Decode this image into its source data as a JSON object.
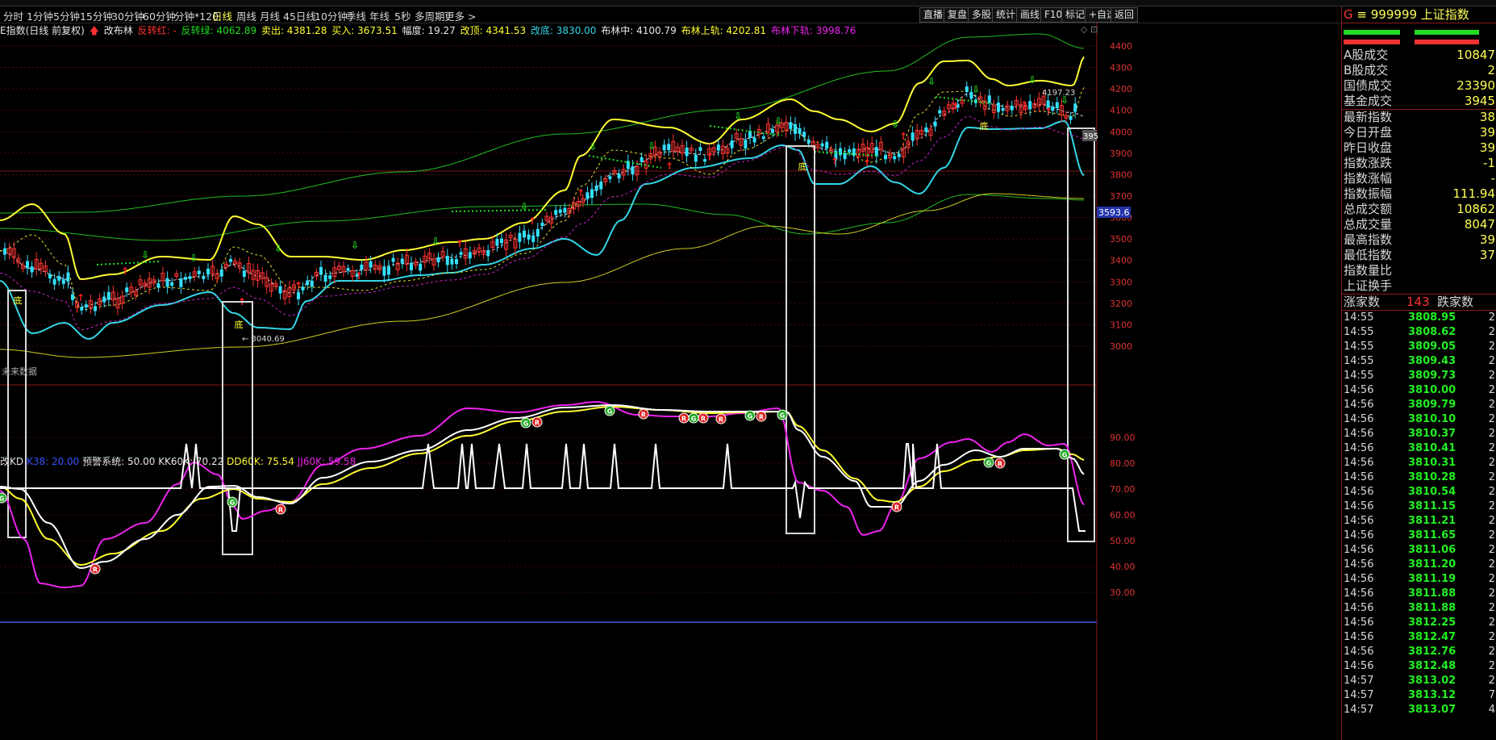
{
  "tabs": [
    "分时",
    "1分钟",
    "5分钟",
    "15分钟",
    "30分钟",
    "60分钟",
    "分钟*120",
    "日线",
    "周线",
    "月线",
    "45日线",
    "10分钟",
    "季线",
    "年线",
    "5秒",
    "多周期",
    "更多 >"
  ],
  "active_tab": "日线",
  "toolbar": [
    "直播",
    "复盘",
    "多股",
    "统计",
    "画线",
    "F10",
    "标记",
    "+自选",
    "返回"
  ],
  "info": {
    "title": "E指数(日线 前复权)",
    "indicator": "改布林",
    "t1": "反转红: -",
    "t2": "反转绿: 4062.89",
    "t3": "卖出: 4381.28",
    "t4": "买入: 3673.51",
    "t5": "幅度: 19.27",
    "t6": "改顶: 4341.53",
    "t7": "改底: 3830.00",
    "t8": "布林中: 4100.79",
    "t9": "布林上轨: 4202.81",
    "t10": "布林下轨: 3998.76"
  },
  "kd_info": {
    "name": "改KD",
    "v1": "K38: 20.00",
    "v2": "预警系统: 50.00",
    "v3": "KK60K: 70.22",
    "v4": "DD60K: 75.54",
    "v5": "JJ60K: 59.58"
  },
  "price_axis": [
    "4400",
    "4300",
    "4200",
    "4100",
    "4000",
    "3900",
    "3800",
    "3700",
    "3600",
    "3500",
    "3400",
    "3300",
    "3200",
    "3100",
    "3000"
  ],
  "kd_axis": [
    "90.00",
    "80.00",
    "70.00",
    "60.00",
    "50.00",
    "40.00",
    "30.00"
  ],
  "markers": {
    "low_label": "3040.69",
    "high_label": "4197.23",
    "current_price": "3593.6",
    "current_right": "395",
    "future_note": "未来数据"
  },
  "colors": {
    "up": "#ff3333",
    "down": "#00e5ff",
    "yellow": "#ffff33",
    "green": "#22cc22",
    "cyan": "#33d6e6",
    "magenta": "#ee22ee",
    "white": "#ffffff",
    "grid": "#5a1010"
  },
  "panel": {
    "title": "999999 上证指数",
    "code_icon": "G",
    "stats": [
      {
        "label": "A股成交",
        "value": "10847"
      },
      {
        "label": "B股成交",
        "value": "2"
      },
      {
        "label": "国债成交",
        "value": "23390"
      },
      {
        "label": "基金成交",
        "value": "3945"
      },
      {
        "label": "最新指数",
        "value": "38"
      },
      {
        "label": "今日开盘",
        "value": "39"
      },
      {
        "label": "昨日收盘",
        "value": "39"
      },
      {
        "label": "指数涨跌",
        "value": "-1"
      },
      {
        "label": "指数涨幅",
        "value": "-"
      },
      {
        "label": "指数振幅",
        "value": "111.94"
      },
      {
        "label": "总成交额",
        "value": "10862"
      },
      {
        "label": "总成交量",
        "value": "8047"
      },
      {
        "label": "最高指数",
        "value": "39"
      },
      {
        "label": "最低指数",
        "value": "37"
      },
      {
        "label": "指数量比",
        "value": ""
      },
      {
        "label": "上证换手",
        "value": ""
      }
    ],
    "breadth": {
      "up_label": "涨家数",
      "up_value": "143",
      "down_label": "跌家数"
    },
    "ticks": [
      {
        "t": "14:55",
        "p": "3808.95",
        "v": "2"
      },
      {
        "t": "14:55",
        "p": "3808.62",
        "v": "2"
      },
      {
        "t": "14:55",
        "p": "3809.05",
        "v": "2"
      },
      {
        "t": "14:55",
        "p": "3809.43",
        "v": "2"
      },
      {
        "t": "14:55",
        "p": "3809.73",
        "v": "2"
      },
      {
        "t": "14:56",
        "p": "3810.00",
        "v": "2"
      },
      {
        "t": "14:56",
        "p": "3809.79",
        "v": "2"
      },
      {
        "t": "14:56",
        "p": "3810.10",
        "v": "2"
      },
      {
        "t": "14:56",
        "p": "3810.37",
        "v": "2"
      },
      {
        "t": "14:56",
        "p": "3810.41",
        "v": "2"
      },
      {
        "t": "14:56",
        "p": "3810.31",
        "v": "2"
      },
      {
        "t": "14:56",
        "p": "3810.28",
        "v": "2"
      },
      {
        "t": "14:56",
        "p": "3810.54",
        "v": "2"
      },
      {
        "t": "14:56",
        "p": "3811.15",
        "v": "2"
      },
      {
        "t": "14:56",
        "p": "3811.21",
        "v": "2"
      },
      {
        "t": "14:56",
        "p": "3811.65",
        "v": "2"
      },
      {
        "t": "14:56",
        "p": "3811.06",
        "v": "2"
      },
      {
        "t": "14:56",
        "p": "3811.20",
        "v": "2"
      },
      {
        "t": "14:56",
        "p": "3811.19",
        "v": "2"
      },
      {
        "t": "14:56",
        "p": "3811.88",
        "v": "2"
      },
      {
        "t": "14:56",
        "p": "3811.88",
        "v": "2"
      },
      {
        "t": "14:56",
        "p": "3812.25",
        "v": "2"
      },
      {
        "t": "14:56",
        "p": "3812.47",
        "v": "2"
      },
      {
        "t": "14:56",
        "p": "3812.76",
        "v": "2"
      },
      {
        "t": "14:56",
        "p": "3812.48",
        "v": "2"
      },
      {
        "t": "14:57",
        "p": "3813.02",
        "v": "2"
      },
      {
        "t": "14:57",
        "p": "3813.12",
        "v": "7"
      },
      {
        "t": "14:57",
        "p": "3813.07",
        "v": "4"
      }
    ]
  }
}
